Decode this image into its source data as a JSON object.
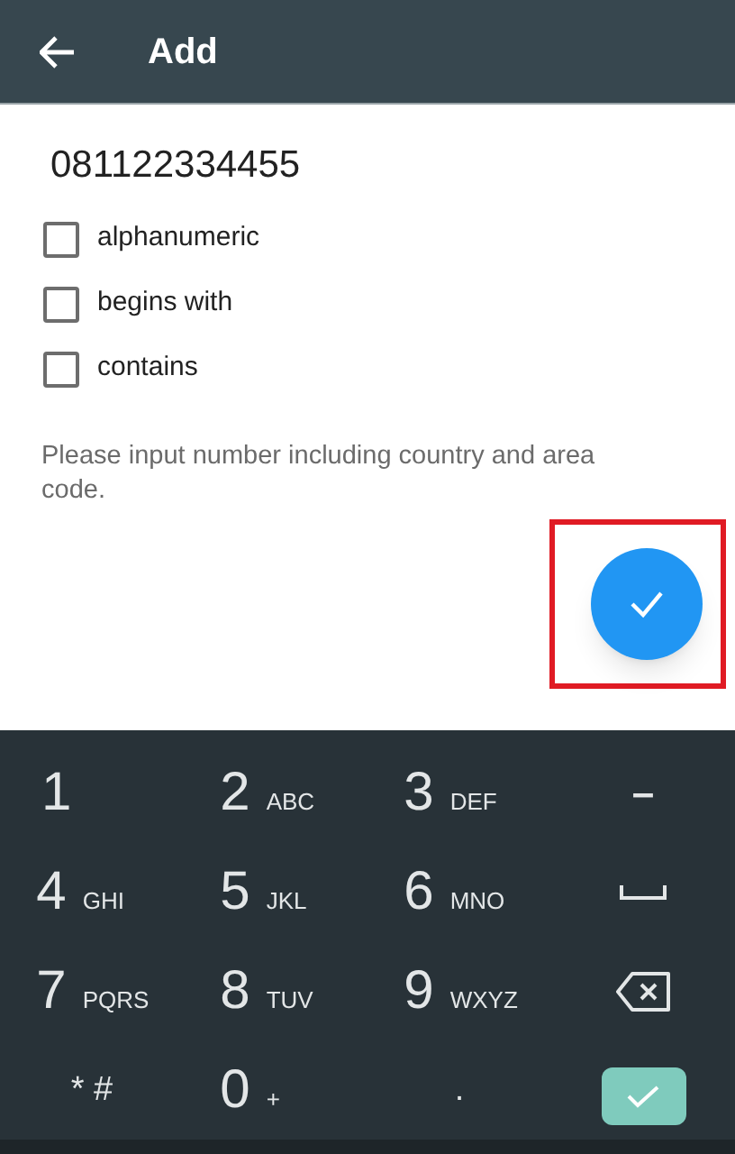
{
  "app_bar": {
    "title": "Add"
  },
  "number_field": {
    "value": "081122334455"
  },
  "options": [
    {
      "label": "alphanumeric",
      "checked": false
    },
    {
      "label": "begins with",
      "checked": false
    },
    {
      "label": "contains",
      "checked": false
    }
  ],
  "hint": "Please input number including country and area code.",
  "fab": {
    "highlighted": true
  },
  "keypad": [
    {
      "kind": "key",
      "main": "1"
    },
    {
      "kind": "key",
      "main": "2",
      "sub": "ABC"
    },
    {
      "kind": "key",
      "main": "3",
      "sub": "DEF"
    },
    {
      "kind": "key",
      "main": "–"
    },
    {
      "kind": "key",
      "main": "4",
      "sub": "GHI"
    },
    {
      "kind": "key",
      "main": "5",
      "sub": "JKL"
    },
    {
      "kind": "key",
      "main": "6",
      "sub": "MNO"
    },
    {
      "kind": "space"
    },
    {
      "kind": "key",
      "main": "7",
      "sub": "PQRS"
    },
    {
      "kind": "key",
      "main": "8",
      "sub": "TUV"
    },
    {
      "kind": "key",
      "main": "9",
      "sub": "WXYZ"
    },
    {
      "kind": "backspace"
    },
    {
      "kind": "small",
      "main": "* #"
    },
    {
      "kind": "key",
      "main": "0",
      "sub": "+"
    },
    {
      "kind": "small",
      "main": "."
    },
    {
      "kind": "done"
    }
  ]
}
